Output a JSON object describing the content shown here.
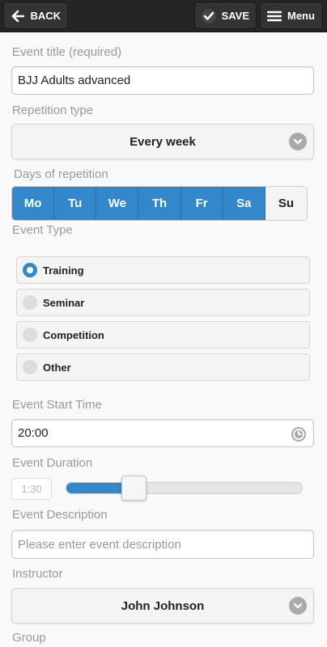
{
  "toolbar": {
    "back_label": "BACK",
    "save_label": "SAVE",
    "menu_label": "Menu"
  },
  "form": {
    "title_label": "Event title (required)",
    "title_value": "BJJ Adults advanced",
    "repetition_label": "Repetition type",
    "repetition_value": "Every week",
    "days_label": "Days of repetition",
    "days": [
      {
        "label": "Mo",
        "selected": true
      },
      {
        "label": "Tu",
        "selected": true
      },
      {
        "label": "We",
        "selected": true
      },
      {
        "label": "Th",
        "selected": true
      },
      {
        "label": "Fr",
        "selected": true
      },
      {
        "label": "Sa",
        "selected": true
      },
      {
        "label": "Su",
        "selected": false
      }
    ],
    "type_label": "Event Type",
    "types": [
      {
        "label": "Training",
        "selected": true
      },
      {
        "label": "Seminar",
        "selected": false
      },
      {
        "label": "Competition",
        "selected": false
      },
      {
        "label": "Other",
        "selected": false
      }
    ],
    "start_label": "Event Start Time",
    "start_value": "20:00",
    "duration_label": "Event Duration",
    "duration_value": "1:30",
    "duration_fraction": 0.29,
    "description_label": "Event Description",
    "description_placeholder": "Please enter event description",
    "instructor_label": "Instructor",
    "instructor_value": "John Johnson",
    "group_label": "Group"
  },
  "colors": {
    "accent": "#3388cc",
    "topbar": "#252525"
  },
  "icons": {
    "back": "arrow-left-icon",
    "save": "check-icon",
    "menu": "hamburger-icon",
    "select": "chevron-down-icon",
    "time": "clock-icon"
  }
}
